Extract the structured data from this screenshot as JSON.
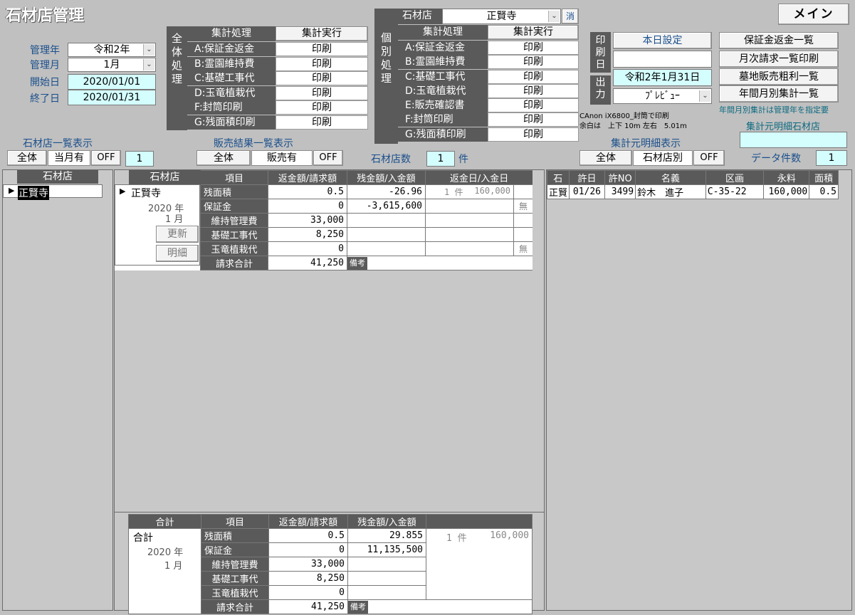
{
  "app": {
    "title": "石材店管理",
    "main_button": "メイン"
  },
  "controls": {
    "year_label": "管理年",
    "year_value": "令和2年",
    "month_label": "管理月",
    "month_value": "1月",
    "start_label": "開始日",
    "start_value": "2020/01/01",
    "end_label": "終了日",
    "end_value": "2020/01/31"
  },
  "global_processing": {
    "side_label": "全体処理",
    "header_left": "集計処理",
    "header_right": "集計実行",
    "rows": [
      {
        "label": "A:保証金返金",
        "action": "印刷"
      },
      {
        "label": "B:霊園維持費",
        "action": "印刷"
      },
      {
        "label": "C:基礎工事代",
        "action": "印刷"
      },
      {
        "label": "D:玉竜植栽代",
        "action": "印刷"
      },
      {
        "label": "F:封筒印刷",
        "action": "印刷"
      },
      {
        "label": "G:残面積印刷",
        "action": "印刷"
      }
    ]
  },
  "individual_processing": {
    "side_label": "個別処理",
    "store_label": "石材店",
    "store_value": "正賢寺",
    "clear": "消",
    "header_left": "集計処理",
    "header_right": "集計実行",
    "rows": [
      {
        "label": "A:保証金返金",
        "action": "印刷"
      },
      {
        "label": "B:霊園維持費",
        "action": "印刷"
      },
      {
        "label": "C:基礎工事代",
        "action": "印刷"
      },
      {
        "label": "D:玉竜植栽代",
        "action": "印刷"
      },
      {
        "label": "E:販売確認書",
        "action": "印刷"
      },
      {
        "label": "F:封筒印刷",
        "action": "印刷"
      },
      {
        "label": "G:残面積印刷",
        "action": "印刷"
      }
    ]
  },
  "print_settings": {
    "print_day_label": "印刷日",
    "today_button": "本日設定",
    "date_value": "令和2年1月31日",
    "output_label": "出力",
    "output_value": "ﾌﾟﾚﾋﾞｭｰ",
    "printer_info": "CAnon iX6800_封筒で印刷",
    "margin_info": "余白は　上下 10m 左右　5.01m"
  },
  "reports": {
    "buttons": [
      "保証金返金一覧",
      "月次請求一覧印刷",
      "墓地販売粗利一覧",
      "年間月別集計一覧"
    ],
    "note": "年間月別集計は管理年を指定要"
  },
  "filters": {
    "store_list_label": "石材店一覧表示",
    "store_list_buttons": [
      "全体",
      "当月有",
      "OFF"
    ],
    "store_list_count": "1",
    "sales_label": "販売結果一覧表示",
    "sales_buttons": [
      "全体",
      "販売有",
      "OFF"
    ],
    "store_count_label": "石材店数",
    "store_count": "1",
    "store_count_unit": "件",
    "detail_label": "集計元明細表示",
    "detail_buttons": [
      "全体",
      "石材店別",
      "OFF"
    ],
    "detail_store_label": "集計元明細石材店",
    "detail_store_value": "",
    "data_count_label": "データ件数",
    "data_count": "1"
  },
  "left_list": {
    "header": "石材店",
    "items": [
      "正賢寺"
    ]
  },
  "middle": {
    "headers": [
      "石材店",
      "項目",
      "返金額/請求額",
      "残金額/入金額",
      "返金日/入金日"
    ],
    "store": "正賢寺",
    "year": "2020 年",
    "month": "1 月",
    "update_button": "更新",
    "detail_button": "明細",
    "rows": [
      {
        "item": "残面積",
        "a": "0.5",
        "b": "-26.96",
        "c1": "1 件",
        "c2": "160,000",
        "flag": ""
      },
      {
        "item": "保証金",
        "a": "0",
        "b": "-3,615,600",
        "c1": "",
        "c2": "",
        "flag": "無"
      },
      {
        "item": "維持管理費",
        "a": "33,000",
        "b": "",
        "c1": "",
        "c2": "",
        "flag": ""
      },
      {
        "item": "基礎工事代",
        "a": "8,250",
        "b": "",
        "c1": "",
        "c2": "",
        "flag": ""
      },
      {
        "item": "玉竜植栽代",
        "a": "0",
        "b": "",
        "c1": "",
        "c2": "",
        "flag": "無"
      }
    ],
    "total_label": "請求合計",
    "total_value": "41,250",
    "remarks_label": "備考"
  },
  "summary": {
    "headers": [
      "合計",
      "項目",
      "返金額/請求額",
      "残金額/入金額"
    ],
    "label": "合計",
    "year": "2020 年",
    "month": "1 月",
    "rows": [
      {
        "item": "残面積",
        "a": "0.5",
        "b": "29.855"
      },
      {
        "item": "保証金",
        "a": "0",
        "b": "11,135,500"
      },
      {
        "item": "維持管理費",
        "a": "33,000",
        "b": ""
      },
      {
        "item": "基礎工事代",
        "a": "8,250",
        "b": ""
      },
      {
        "item": "玉竜植栽代",
        "a": "0",
        "b": ""
      }
    ],
    "count": "1 件",
    "amount": "160,000",
    "total_label": "請求合計",
    "total_value": "41,250",
    "remarks_label": "備考"
  },
  "right": {
    "headers": [
      "石",
      "許日",
      "許NO",
      "名義",
      "区画",
      "永料",
      "面積"
    ],
    "rows": [
      {
        "s": "正賢",
        "date": "01/26",
        "no": "3499",
        "name": "鈴木　進子",
        "plot": "C-35-22",
        "fee": "160,000",
        "area": "0.5"
      }
    ]
  }
}
